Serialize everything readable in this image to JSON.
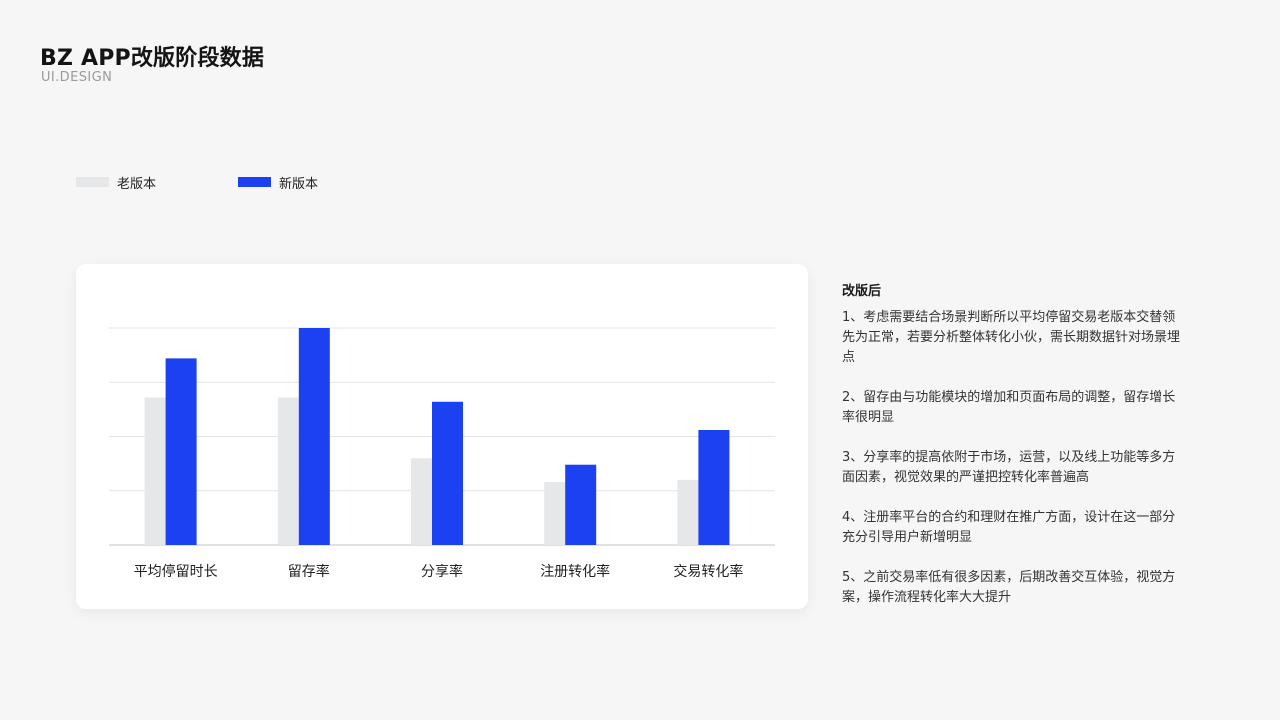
{
  "header": {
    "title": "BZ APP改版阶段数据",
    "subtitle": "UI.DESIGN"
  },
  "legend": {
    "items": [
      {
        "label": "老版本",
        "color": "#e6e7e9"
      },
      {
        "label": "新版本",
        "color": "#1c41f0"
      }
    ]
  },
  "chart_data": {
    "type": "bar",
    "categories": [
      "平均停留时长",
      "留存率",
      "分享率",
      "注册转化率",
      "交易转化率"
    ],
    "series": [
      {
        "name": "老版本",
        "color": "#e6e7e9",
        "values": [
          68,
          68,
          40,
          29,
          30
        ]
      },
      {
        "name": "新版本",
        "color": "#1c41f0",
        "values": [
          86,
          100,
          66,
          37,
          53
        ]
      }
    ],
    "ylim": [
      0,
      100
    ],
    "gridlines": [
      25,
      50,
      75,
      100
    ],
    "grid": true,
    "legend_position": "top-left",
    "y_axis_labels_shown": false
  },
  "notes": {
    "title": "改版后",
    "items": [
      "1、考虑需要结合场景判断所以平均停留交易老版本交替领先为正常，若要分析整体转化小伙，需长期数据针对场景埋点",
      "2、留存由与功能模块的增加和页面布局的调整，留存增长率很明显",
      "3、分享率的提高依附于市场，运营，以及线上功能等多方面因素，视觉效果的严谨把控转化率普遍高",
      "4、注册率平台的合约和理财在推广方面，设计在这一部分充分引导用户新增明显",
      "5、之前交易率低有很多因素，后期改善交互体验，视觉方案，操作流程转化率大大提升"
    ]
  }
}
